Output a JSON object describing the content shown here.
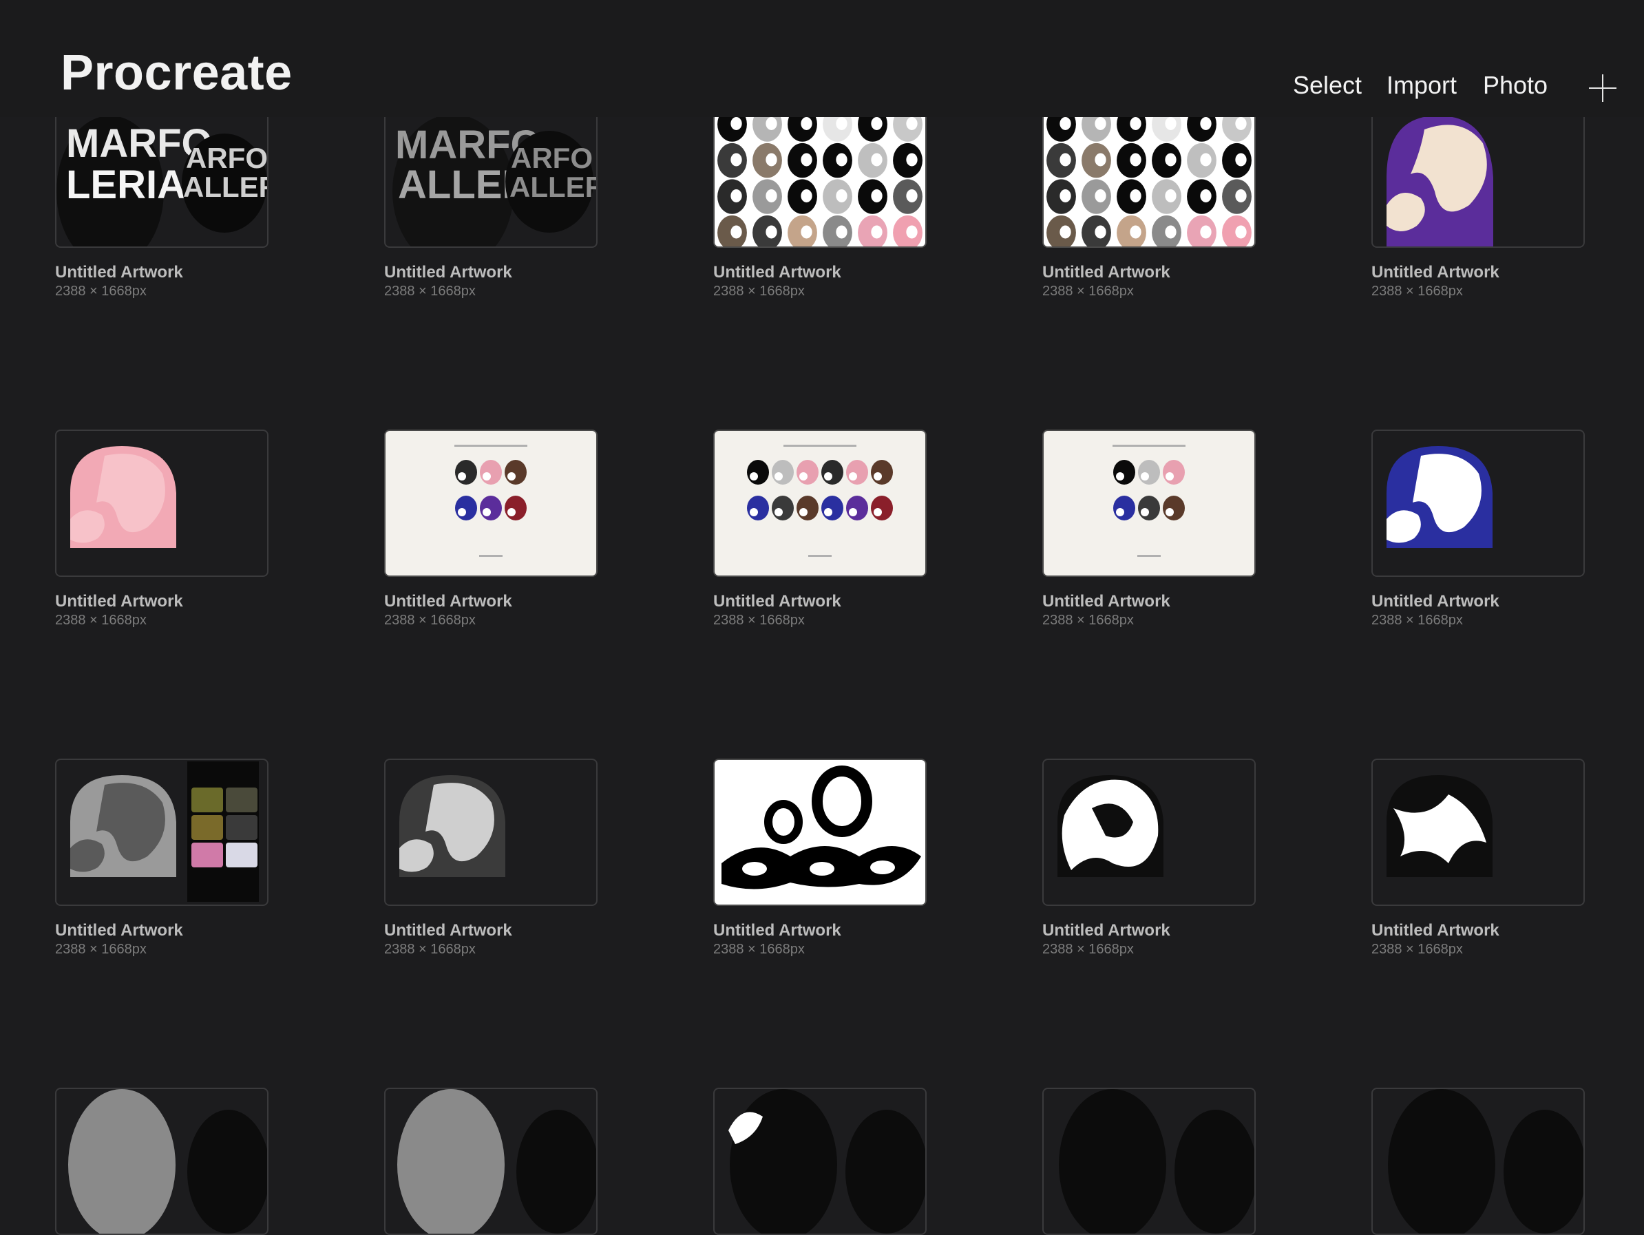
{
  "app": {
    "title": "Procreate",
    "actions": {
      "select": "Select",
      "import": "Import",
      "photo": "Photo"
    }
  },
  "colors": {
    "background": "#1c1c1e",
    "beanie_pink": "#f2a9b5",
    "beanie_purple": "#5b2d9b",
    "beanie_blue": "#2a2fa0",
    "beanie_cream": "#f2e2d0"
  },
  "artworks": [
    {
      "title": "Untitled Artwork",
      "dims": "2388 × 1668px"
    },
    {
      "title": "Untitled Artwork",
      "dims": "2388 × 1668px"
    },
    {
      "title": "Untitled Artwork",
      "dims": "2388 × 1668px"
    },
    {
      "title": "Untitled Artwork",
      "dims": "2388 × 1668px"
    },
    {
      "title": "Untitled Artwork",
      "dims": "2388 × 1668px"
    },
    {
      "title": "Untitled Artwork",
      "dims": "2388 × 1668px"
    },
    {
      "title": "Untitled Artwork",
      "dims": "2388 × 1668px"
    },
    {
      "title": "Untitled Artwork",
      "dims": "2388 × 1668px"
    },
    {
      "title": "Untitled Artwork",
      "dims": "2388 × 1668px"
    },
    {
      "title": "Untitled Artwork",
      "dims": "2388 × 1668px"
    },
    {
      "title": "Untitled Artwork",
      "dims": "2388 × 1668px"
    },
    {
      "title": "Untitled Artwork",
      "dims": "2388 × 1668px"
    },
    {
      "title": "Untitled Artwork",
      "dims": "2388 × 1668px"
    },
    {
      "title": "Untitled Artwork",
      "dims": "2388 × 1668px"
    },
    {
      "title": "Untitled Artwork",
      "dims": "2388 × 1668px"
    }
  ],
  "thumbnail_text": {
    "marfo_1": "MARFO",
    "galleria_1": "GALLERIA",
    "marfo_2": "MARFO",
    "galleria_2": "ALLERI"
  }
}
